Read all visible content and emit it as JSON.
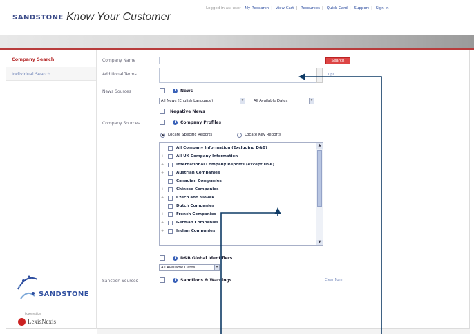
{
  "header": {
    "logo_text": "SANDSTONE",
    "app_title": "Know Your Customer",
    "user_text": "Logged in as: user",
    "nav_links": [
      "My Research",
      "View Cart",
      "Resources",
      "Quick Card",
      "Support",
      "Sign In"
    ]
  },
  "leftnav": {
    "tabs": [
      "Company Search",
      "Individual Search"
    ],
    "logo_text": "SANDSTONE",
    "powered_by": "Powered by",
    "lexis_text": "LexisNexis"
  },
  "form": {
    "company_name_label": "Company Name",
    "company_name_value": "",
    "search_button": "Search",
    "additional_terms_label": "Additional Terms",
    "additional_terms_value": "",
    "tips_link": "Tips",
    "news_sources_label": "News Sources",
    "news_label": "News",
    "news_select": "All News (English Language)",
    "dates_select": "All Available Dates",
    "negative_news_label": "Negative News",
    "company_sources_label": "Company Sources",
    "company_profiles_label": "Company Profiles",
    "radio_specific": "Locate Specific Reports",
    "radio_key": "Locate Key Reports",
    "report_items": [
      "All Company Information (Excluding D&B)",
      "All UK Company Information",
      "International Company Reports (except USA)",
      "Austrian Companies",
      "Canadian Companies",
      "Chinese Companies",
      "Czech and Slovak",
      "Dutch Companies",
      "French Companies",
      "German Companies",
      "Indian Companies"
    ],
    "dnb_label": "D&B Global Identifiers",
    "dnb_dates_select": "All Available Dates",
    "sanction_sources_label": "Sanction Sources",
    "sanctions_label": "Sanctions & Warnings",
    "clear_form": "Clear Form"
  },
  "colors": {
    "accent_red": "#b83030",
    "link_blue": "#2f4fa0",
    "annotation": "#0f3b66"
  }
}
